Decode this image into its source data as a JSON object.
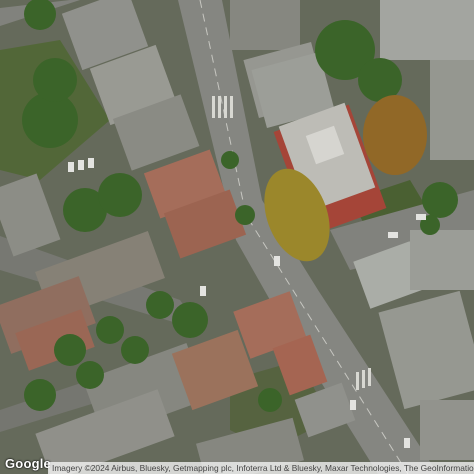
{
  "map": {
    "type": "satellite",
    "logo_text": "Google",
    "attribution": "Imagery ©2024 Airbus, Bluesky, Getmapping plc, Infoterra Ltd & Bluesky, Maxar Technologies, The GeoInformation Group",
    "colors": {
      "road": "#8e8f8a",
      "roof_grey": "#9a9b95",
      "roof_red": "#b07460",
      "tree": "#3f6b2c",
      "autumn_tree": "#a5902e",
      "brick_building": "#b04a3c"
    }
  }
}
